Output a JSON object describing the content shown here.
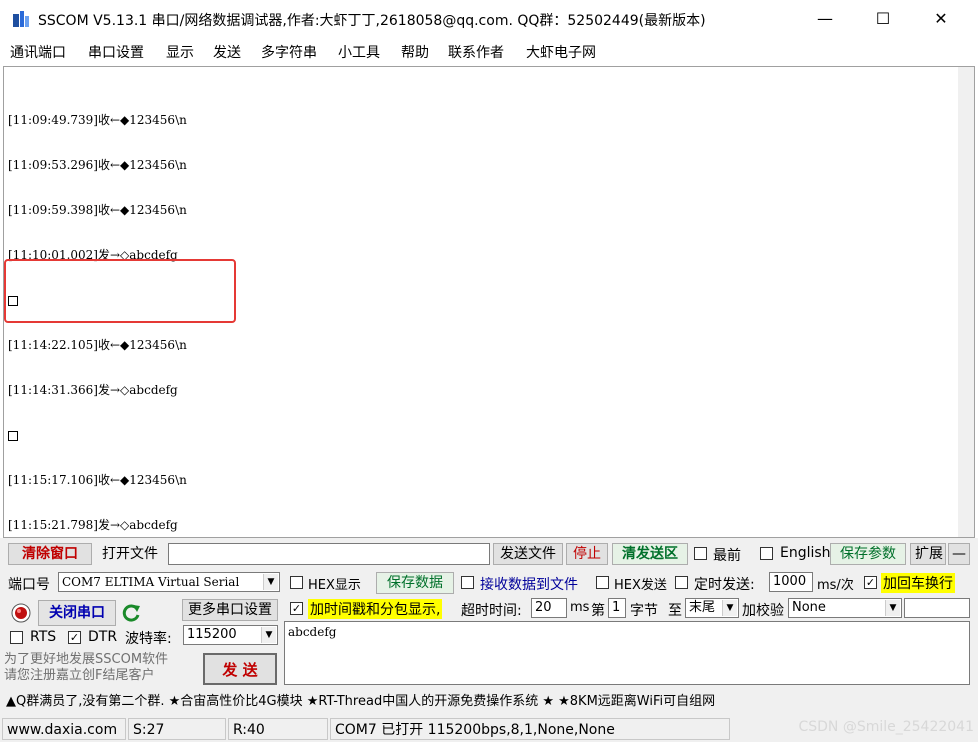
{
  "window": {
    "title": "SSCOM V5.13.1 串口/网络数据调试器,作者:大虾丁丁,2618058@qq.com. QQ群：52502449(最新版本)",
    "minimize": "—",
    "maximize": "☐",
    "close": "✕"
  },
  "menu": [
    "通讯端口",
    "串口设置",
    "显示",
    "发送",
    "多字符串",
    "小工具",
    "帮助",
    "联系作者",
    "大虾电子网"
  ],
  "receive": {
    "lines": [
      "[11:09:49.739]收←◆123456\\n",
      "[11:09:53.296]收←◆123456\\n",
      "[11:09:59.398]收←◆123456\\n",
      "[11:10:01.002]发→◇abcdefg",
      "",
      "[11:14:22.105]收←◆123456\\n",
      "[11:14:31.366]发→◇abcdefg",
      "",
      "[11:15:17.106]收←◆123456\\n",
      "[11:15:21.798]发→◇abcdefg",
      ""
    ]
  },
  "toolbar": {
    "clear_window": "清除窗口",
    "open_file": "打开文件",
    "send_file": "发送文件",
    "stop": "停止",
    "clear_send_area": "清发送区",
    "topmost": "最前",
    "english": "English",
    "save_params": "保存参数",
    "expand": "扩展",
    "collapse": "—"
  },
  "port": {
    "port_label": "端口号",
    "port_value": "COM7 ELTIMA Virtual Serial",
    "close_port": "关闭串口",
    "more_settings": "更多串口设置",
    "rts": "RTS",
    "dtr": "DTR",
    "baud_label": "波特率:",
    "baud_value": "115200",
    "promo": "为了更好地发展SSCOM软件\n请您注册嘉立创F结尾客户",
    "send": "发  送"
  },
  "options": {
    "hex_display": "HEX显示",
    "save_data": "保存数据",
    "recv_to_file": "接收数据到文件",
    "hex_send": "HEX发送",
    "timed_send": "定时发送:",
    "timed_value": "1000",
    "timed_unit": "ms/次",
    "add_crlf": "加回车换行",
    "add_timestamp": "加时间戳和分包显示,",
    "timeout_label": "超时时间:",
    "timeout_value": "20",
    "timeout_unit": "ms",
    "byte_prefix": "第",
    "byte_value": "1",
    "byte_suffix": "字节",
    "to_label": "至",
    "end_value": "末尾",
    "checksum_label": "加校验",
    "checksum_value": "None"
  },
  "send_text": "abcdefg",
  "ad_text": "▲Q群满员了,没有第二个群. ★合宙高性价比4G模块 ★RT-Thread中国人的开源免费操作系统 ★ ★8KM远距离WiFi可自组网",
  "status": {
    "site": "www.daxia.com",
    "sent": "S:27",
    "recv": "R:40",
    "port_state": "COM7 已打开  115200bps,8,1,None,None"
  },
  "watermark": "CSDN @Smile_25422041",
  "colors": {
    "highlight_border": "#e53935",
    "yellow": "#ffff00",
    "red_text": "#c00000",
    "green_text": "#00702a"
  }
}
